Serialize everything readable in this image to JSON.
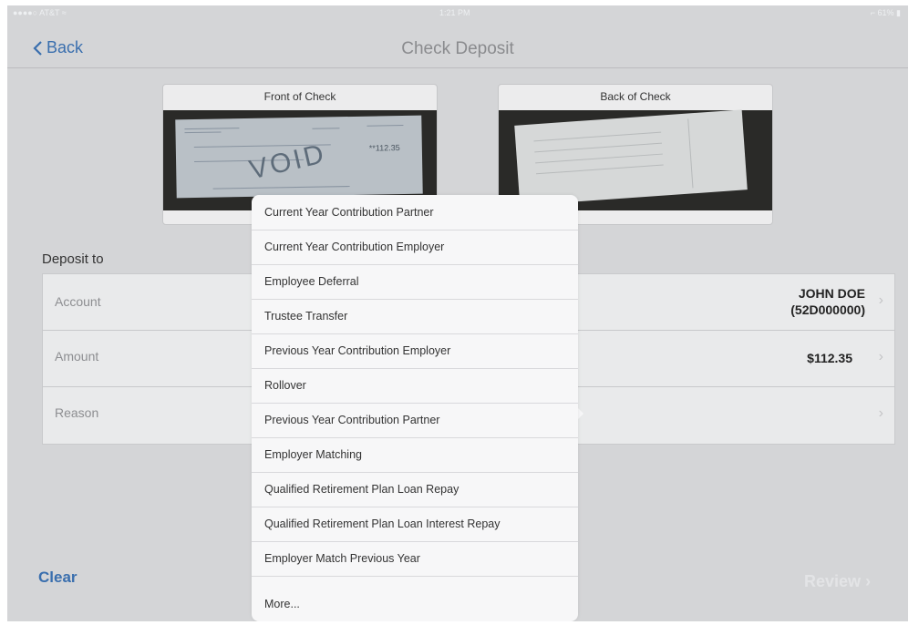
{
  "statusbar": {
    "carrier": "●●●●○ AT&T ≈",
    "time": "1:21 PM",
    "battery": "⌐ 61% ▮"
  },
  "navbar": {
    "back_label": "Back",
    "title": "Check Deposit"
  },
  "checks": {
    "front_label": "Front of Check",
    "back_label": "Back of Check",
    "front_amount": "**112.35",
    "void_text": "VOID"
  },
  "deposit": {
    "section_label": "Deposit to",
    "rows": [
      {
        "label": "Account",
        "value_line1": "JOHN DOE",
        "value_line2": "(52D000000)"
      },
      {
        "label": "Amount",
        "value": "$112.35"
      },
      {
        "label": "Reason",
        "value": ""
      }
    ]
  },
  "footer": {
    "clear_label": "Clear",
    "review_label": "Review"
  },
  "popover": {
    "items": [
      "Current Year Contribution Partner",
      "Current Year Contribution Employer",
      "Employee Deferral",
      "Trustee Transfer",
      "Previous Year Contribution Employer",
      "Rollover",
      "Previous Year Contribution Partner",
      "Employer Matching",
      "Qualified Retirement Plan Loan Repay",
      "Qualified Retirement Plan Loan Interest Repay",
      "Employer Match Previous Year",
      "More..."
    ]
  },
  "colors": {
    "accent": "#3a6fae",
    "background": "#d4d5d7"
  }
}
